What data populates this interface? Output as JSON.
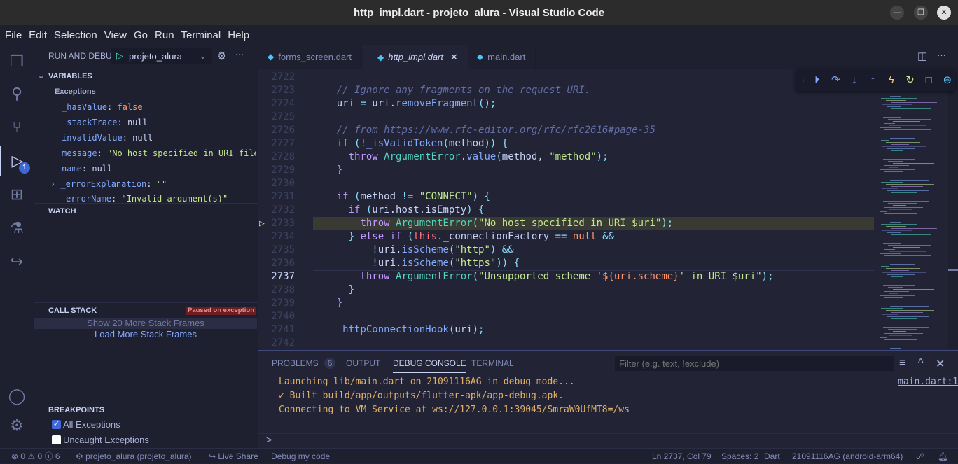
{
  "window": {
    "title": "http_impl.dart - projeto_alura - Visual Studio Code"
  },
  "menu": [
    "File",
    "Edit",
    "Selection",
    "View",
    "Go",
    "Run",
    "Terminal",
    "Help"
  ],
  "activity_bar": {
    "debug_badge": "1"
  },
  "sidebar": {
    "header": "RUN AND DEBUG",
    "config": "projeto_alura",
    "variables_title": "VARIABLES",
    "exceptions_label": "Exceptions",
    "vars": [
      {
        "name": "_hasValue",
        "value": "false",
        "kind": "bool"
      },
      {
        "name": "_stackTrace",
        "value": "null",
        "kind": "plain"
      },
      {
        "name": "invalidValue",
        "value": "null",
        "kind": "plain"
      },
      {
        "name": "message",
        "value": "\"No host specified in URI file://…",
        "kind": "string"
      },
      {
        "name": "name",
        "value": "null",
        "kind": "plain"
      },
      {
        "name": "_errorExplanation",
        "value": "\"\"",
        "kind": "string"
      },
      {
        "name": "errorName",
        "value": "\"Invalid argument(s)\"",
        "kind": "string"
      }
    ],
    "watch_title": "WATCH",
    "callstack_title": "CALL STACK",
    "paused_badge": "Paused on exception",
    "show_more": "Show 20 More Stack Frames",
    "load_more": "Load More Stack Frames",
    "breakpoints_title": "BREAKPOINTS",
    "breakpoints": [
      {
        "label": "All Exceptions",
        "checked": true
      },
      {
        "label": "Uncaught Exceptions",
        "checked": false
      }
    ]
  },
  "tabs": [
    {
      "label": "forms_screen.dart"
    },
    {
      "label": "http_impl.dart",
      "active": true
    },
    {
      "label": "main.dart"
    }
  ],
  "editor": {
    "current_line": 2737,
    "paused_line": 2733,
    "lines": [
      {
        "n": 2722,
        "t": []
      },
      {
        "n": 2723,
        "t": [
          [
            "    ",
            "pl"
          ],
          [
            "// Ignore any fragments on the request URI.",
            "cm"
          ]
        ]
      },
      {
        "n": 2724,
        "t": [
          [
            "    uri ",
            "pl"
          ],
          [
            "=",
            "op"
          ],
          [
            " uri.",
            "pl"
          ],
          [
            "removeFragment",
            "fn"
          ],
          [
            "();",
            "pu"
          ]
        ]
      },
      {
        "n": 2725,
        "t": []
      },
      {
        "n": 2726,
        "t": [
          [
            "    // from ",
            "cm"
          ],
          [
            "https://www.rfc-editor.org/rfc/rfc2616#page-35",
            "url"
          ]
        ]
      },
      {
        "n": 2727,
        "t": [
          [
            "    if",
            "kw"
          ],
          [
            " (",
            "pu"
          ],
          [
            "!",
            "op"
          ],
          [
            "_isValidToken",
            "fn"
          ],
          [
            "(",
            "pu"
          ],
          [
            "method",
            "pl"
          ],
          [
            ")) {",
            "pu"
          ]
        ]
      },
      {
        "n": 2728,
        "t": [
          [
            "      throw ",
            "kw"
          ],
          [
            "ArgumentError",
            "cls"
          ],
          [
            ".",
            "pl"
          ],
          [
            "value",
            "fn"
          ],
          [
            "(",
            "pu"
          ],
          [
            "method, ",
            "pl"
          ],
          [
            "\"method\"",
            "str"
          ],
          [
            ");",
            "pu"
          ]
        ]
      },
      {
        "n": 2729,
        "t": [
          [
            "    }",
            "kw"
          ]
        ]
      },
      {
        "n": 2730,
        "t": []
      },
      {
        "n": 2731,
        "t": [
          [
            "    if",
            "kw"
          ],
          [
            " (",
            "pu"
          ],
          [
            "method ",
            "pl"
          ],
          [
            "!=",
            "op"
          ],
          [
            " \"CONNECT\"",
            "str"
          ],
          [
            ") {",
            "pu"
          ]
        ]
      },
      {
        "n": 2732,
        "t": [
          [
            "      if",
            "kw"
          ],
          [
            " (",
            "pu"
          ],
          [
            "uri.host.isEmpty",
            "pl"
          ],
          [
            ") {",
            "pu"
          ]
        ]
      },
      {
        "n": 2733,
        "t": [
          [
            "        ",
            "pl"
          ],
          [
            "throw ",
            "kw"
          ],
          [
            "ArgumentError",
            "cls"
          ],
          [
            "(",
            "pu"
          ],
          [
            "\"No host specified in URI $uri\"",
            "str"
          ],
          [
            ");",
            "pu"
          ]
        ]
      },
      {
        "n": 2734,
        "t": [
          [
            "      } ",
            "pu"
          ],
          [
            "else if",
            "kw"
          ],
          [
            " (",
            "pu"
          ],
          [
            "this",
            "th"
          ],
          [
            ".",
            "pl"
          ],
          [
            "_connectionFactory ",
            "pl"
          ],
          [
            "==",
            "op"
          ],
          [
            " null",
            "nu"
          ],
          [
            " &&",
            "op"
          ]
        ]
      },
      {
        "n": 2735,
        "t": [
          [
            "          !",
            "op"
          ],
          [
            "uri.",
            "pl"
          ],
          [
            "isScheme",
            "fn"
          ],
          [
            "(",
            "pu"
          ],
          [
            "\"http\"",
            "str"
          ],
          [
            ") ",
            "pu"
          ],
          [
            "&&",
            "op"
          ]
        ]
      },
      {
        "n": 2736,
        "t": [
          [
            "          !",
            "op"
          ],
          [
            "uri.",
            "pl"
          ],
          [
            "isScheme",
            "fn"
          ],
          [
            "(",
            "pu"
          ],
          [
            "\"https\"",
            "str"
          ],
          [
            ")) {",
            "pu"
          ]
        ]
      },
      {
        "n": 2737,
        "t": [
          [
            "        throw ",
            "kw"
          ],
          [
            "ArgumentError",
            "cls"
          ],
          [
            "(",
            "pu"
          ],
          [
            "\"Unsupported scheme '",
            "str"
          ],
          [
            "${uri.scheme}",
            "nu"
          ],
          [
            "' in URI $uri\"",
            "str"
          ],
          [
            ");",
            "pu"
          ]
        ]
      },
      {
        "n": 2738,
        "t": [
          [
            "      }",
            "pu"
          ]
        ]
      },
      {
        "n": 2739,
        "t": [
          [
            "    }",
            "kw"
          ]
        ]
      },
      {
        "n": 2740,
        "t": []
      },
      {
        "n": 2741,
        "t": [
          [
            "    ",
            "pl"
          ],
          [
            "_httpConnectionHook",
            "fn"
          ],
          [
            "(",
            "pu"
          ],
          [
            "uri",
            "pl"
          ],
          [
            ");",
            "pu"
          ]
        ]
      },
      {
        "n": 2742,
        "t": []
      }
    ]
  },
  "debug_toolbar": [
    "continue-icon",
    "step-over-icon",
    "step-into-icon",
    "step-out-icon",
    "hot-reload-icon",
    "restart-icon",
    "stop-icon",
    "devtools-icon"
  ],
  "panel": {
    "tabs": [
      "PROBLEMS",
      "OUTPUT",
      "DEBUG CONSOLE",
      "TERMINAL"
    ],
    "problems_count": "6",
    "active_tab": "DEBUG CONSOLE",
    "filter_placeholder": "Filter (e.g. text, !exclude)",
    "console": [
      "Launching lib/main.dart on 21091116AG in debug mode...",
      "✓  Built build/app/outputs/flutter-apk/app-debug.apk.",
      "Connecting to VM Service at ws://127.0.0.1:39045/SmraW0UfMT8=/ws"
    ],
    "source_link": "main.dart:1",
    "prompt": ">"
  },
  "status": {
    "errors": "0",
    "warnings": "0",
    "info": "6",
    "project": "projeto_alura (projeto_alura)",
    "live_share": "Live Share",
    "debug_my_code": "Debug my code",
    "position": "Ln 2737, Col 79",
    "spaces": "Spaces: 2",
    "language": "Dart",
    "device": "21091116AG (android-arm64)"
  },
  "colors": {
    "editor_bg": "#222436",
    "sidebar_bg": "#1e2030",
    "paused_line": "#3a3a35",
    "accent": "#82aaff"
  }
}
